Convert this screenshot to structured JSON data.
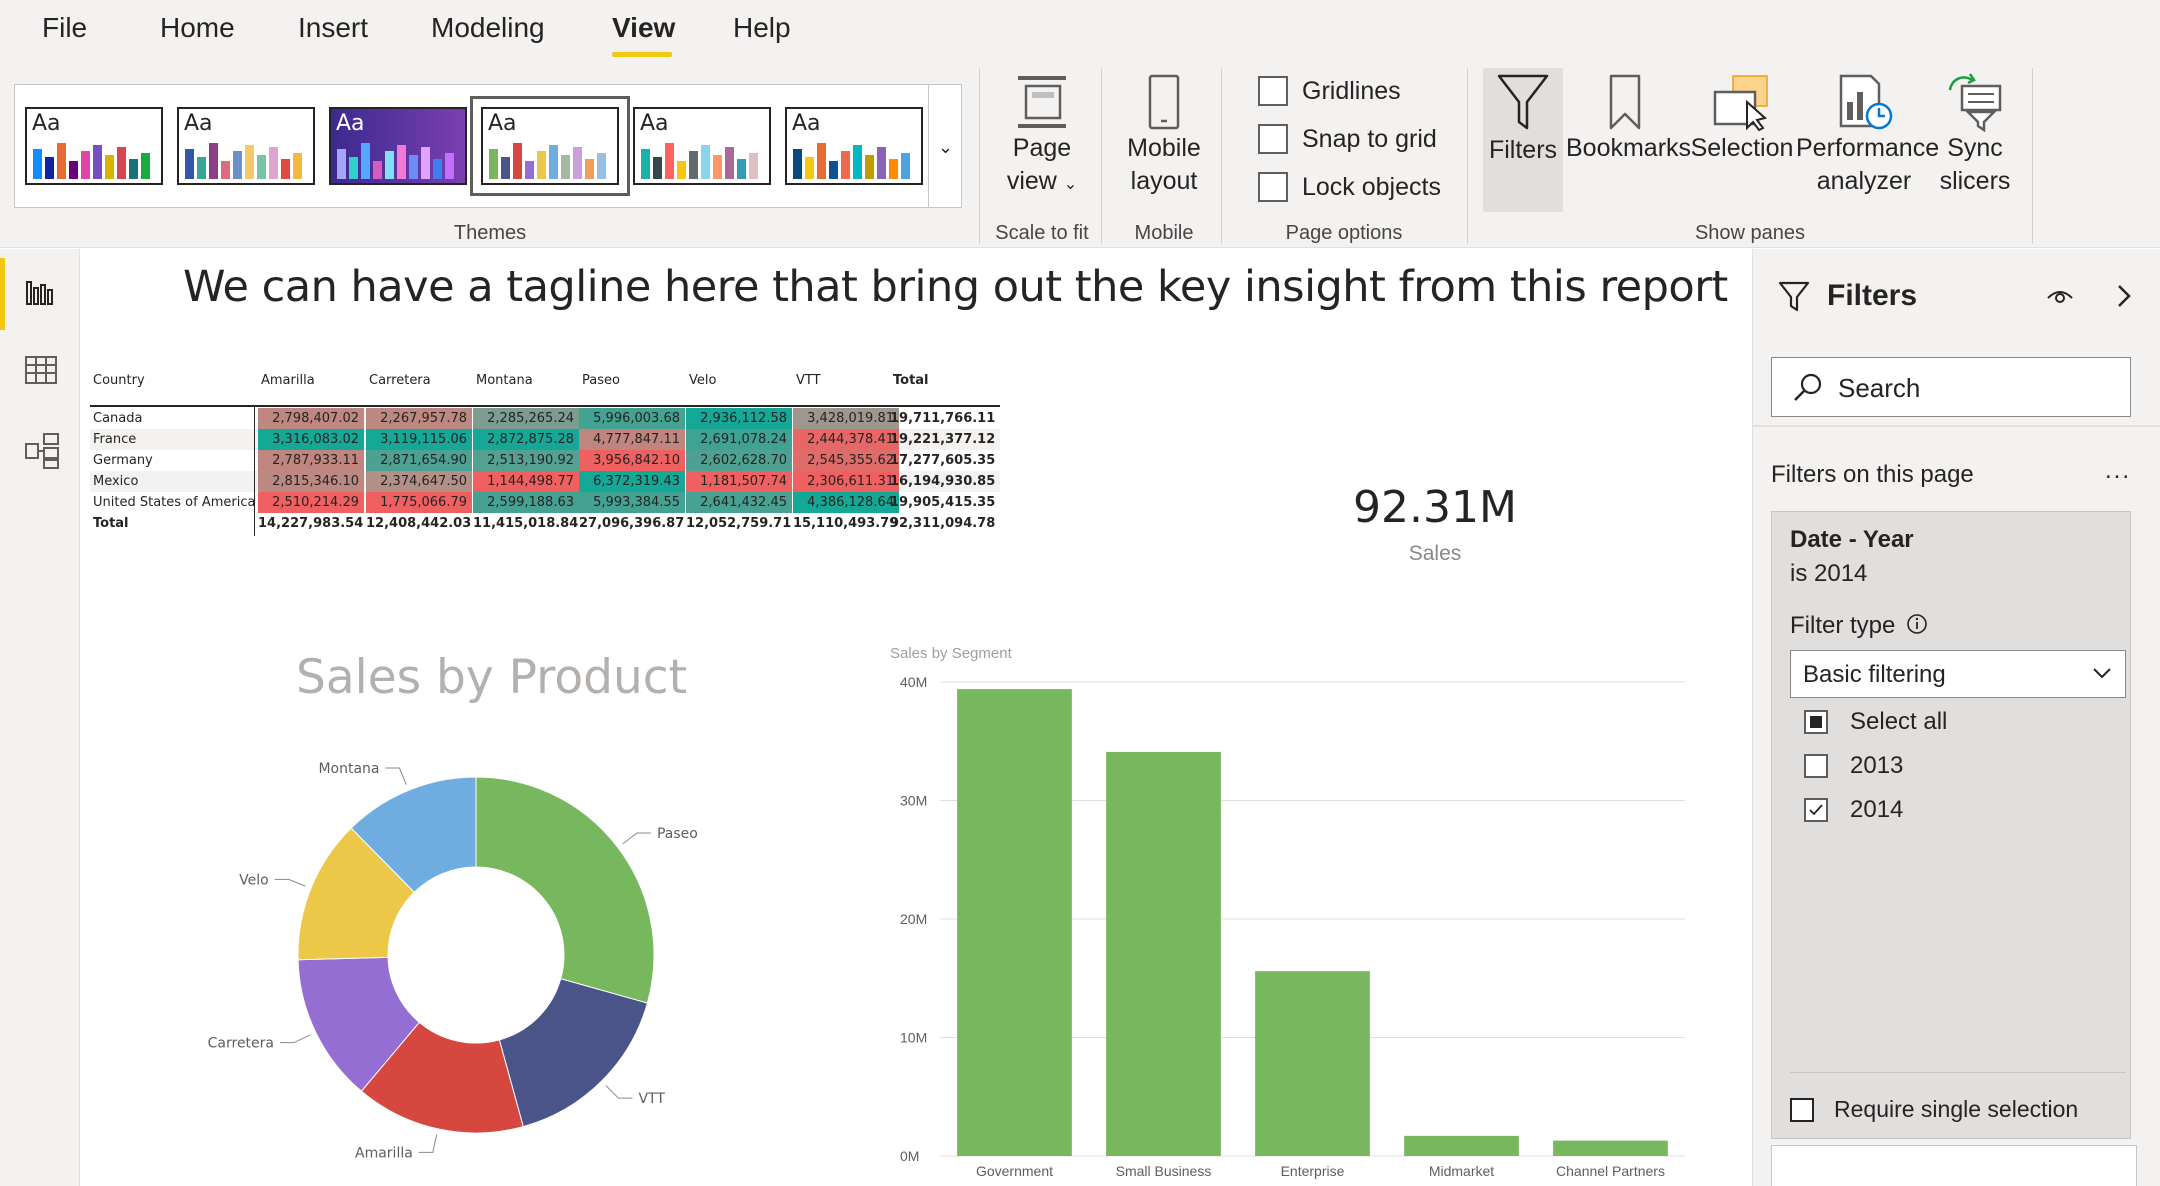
{
  "menu": {
    "items": [
      "File",
      "Home",
      "Insert",
      "Modeling",
      "View",
      "Help"
    ],
    "active": "View"
  },
  "ribbon": {
    "groups": {
      "themes": "Themes",
      "scale": "Scale to fit",
      "mobile": "Mobile",
      "page_options": "Page options",
      "show_panes": "Show panes"
    },
    "theme_label": "Aa",
    "page_view": [
      "Page",
      "view"
    ],
    "mobile_layout": [
      "Mobile",
      "layout"
    ],
    "checkboxes": [
      "Gridlines",
      "Snap to grid",
      "Lock objects"
    ],
    "panes": {
      "filters": "Filters",
      "bookmarks": "Bookmarks",
      "selection": "Selection",
      "performance": [
        "Performance",
        "analyzer"
      ],
      "sync": [
        "Sync",
        "slicers"
      ]
    }
  },
  "canvas": {
    "tagline": "We can have a tagline here that bring out the key insight from this report"
  },
  "matrix": {
    "headers": [
      "Country",
      "Amarilla",
      "Carretera",
      "Montana",
      "Paseo",
      "Velo",
      "VTT",
      "Total"
    ],
    "rows": [
      {
        "country": "Canada",
        "values": [
          "2,798,407.02",
          "2,267,957.78",
          "2,285,265.24",
          "5,996,003.68",
          "2,936,112.58",
          "3,428,019.81",
          "19,711,766.11"
        ]
      },
      {
        "country": "France",
        "values": [
          "3,316,083.02",
          "3,119,115.06",
          "2,872,875.28",
          "4,777,847.11",
          "2,691,078.24",
          "2,444,378.41",
          "19,221,377.12"
        ]
      },
      {
        "country": "Germany",
        "values": [
          "2,787,933.11",
          "2,871,654.90",
          "2,513,190.92",
          "3,956,842.10",
          "2,602,628.70",
          "2,545,355.62",
          "17,277,605.35"
        ]
      },
      {
        "country": "Mexico",
        "values": [
          "2,815,346.10",
          "2,374,647.50",
          "1,144,498.77",
          "6,372,319.43",
          "1,181,507.74",
          "2,306,611.31",
          "16,194,930.85"
        ]
      },
      {
        "country": "United States of America",
        "values": [
          "2,510,214.29",
          "1,775,066.79",
          "2,599,188.63",
          "5,993,384.55",
          "2,641,432.45",
          "4,386,128.64",
          "19,905,415.35"
        ]
      }
    ],
    "total": {
      "label": "Total",
      "values": [
        "14,227,983.54",
        "12,408,442.03",
        "11,415,018.84",
        "27,096,396.87",
        "12,052,759.71",
        "15,110,493.79",
        "92,311,094.78"
      ]
    }
  },
  "kpi": {
    "value": "92.31M",
    "label": "Sales"
  },
  "chart_data": [
    {
      "type": "pie",
      "title": "Sales by Product",
      "categories": [
        "Paseo",
        "VTT",
        "Amarilla",
        "Carretera",
        "Velo",
        "Montana"
      ],
      "values": [
        27096396.87,
        15110493.79,
        14227983.54,
        12408442.03,
        12052759.71,
        11415018.84
      ],
      "colors": [
        "#77b75e",
        "#4a5488",
        "#d6473f",
        "#946ed3",
        "#edc748",
        "#6fade0"
      ]
    },
    {
      "type": "bar",
      "title": "Sales by Segment",
      "categories": [
        "Government",
        "Small Business",
        "Enterprise",
        "Midmarket",
        "Channel Partners"
      ],
      "values": [
        39400000,
        34100000,
        15600000,
        1700000,
        1300000
      ],
      "yticks": [
        "0M",
        "10M",
        "20M",
        "30M",
        "40M"
      ],
      "ylim": [
        0,
        40000000
      ],
      "grid": true,
      "color": "#77b75e"
    }
  ],
  "filters_pane": {
    "title": "Filters",
    "search_placeholder": "Search",
    "section": "Filters on this page",
    "more": "...",
    "card": {
      "title": "Date - Year",
      "subtitle": "is 2014",
      "filter_type_label": "Filter type",
      "filter_type_value": "Basic filtering",
      "options": [
        {
          "label": "Select all",
          "state": "partial"
        },
        {
          "label": "2013",
          "state": "unchecked"
        },
        {
          "label": "2014",
          "state": "checked"
        }
      ],
      "require_single": "Require single selection"
    }
  }
}
